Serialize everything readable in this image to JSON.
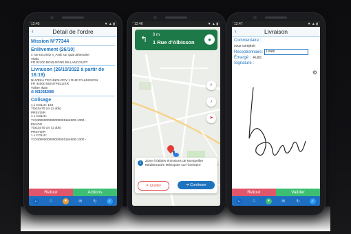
{
  "phone1": {
    "statusbar_left": "12:45",
    "statusbar_right": "▼ ▲ ▮",
    "title": "Détail de l'ordre",
    "mission": "Mission N°77344",
    "enlevement": {
      "heading": "Enlèvement (26/10)",
      "lines": [
        "4 rue ISLAND 4_ANE sur quai athenaise",
        "Vitalo",
        "FR 92100 BOULOGNE BILLANCOURT"
      ]
    },
    "livraison": {
      "heading": "Livraison (26/10/2022 à partir de 16:19)",
      "lines": [
        "NUVEKA TECHNOLOGY 1 RUE D'ALBISSON",
        "FR 34000 MONTPELLIER",
        "Volker Ikam"
      ],
      "phone": "0610582680"
    },
    "colisage": {
      "heading": "Colisage",
      "lines": [
        "1 x COLIS: 123",
        "70x15x70 cm (1 obk)",
        "PREVOIR",
        "1 x COLIS:",
        "Y234000000000000001164900-1300 -",
        "ENLOG",
        "70x15x70 cm (1 obk)",
        "PREVOIR",
        "1 x COLIS:",
        "Y234000000000000001164900-1300 -"
      ]
    },
    "retour_label": "Retour",
    "actions_label": "Actions"
  },
  "phone2": {
    "statusbar_left": "12:46",
    "statusbar_right": "▼ ▲ ▮",
    "distance": "0 m",
    "street": "1 Rue d'Albisson",
    "zone_text": "Zone à faibles émissions de Montpellier Méditerranée Métropole sur l'itinéraire",
    "quitter_label": "Quitter",
    "continuer_label": "Continuer",
    "place_label": "Place de la Comédie",
    "colors": {
      "nav_green": "#1d7a48",
      "route_blue": "#1e73be"
    }
  },
  "phone3": {
    "statusbar_left": "12:47",
    "statusbar_right": "▼ ▲ ▮",
    "title": "Livraison",
    "commentaire_label": "Commentaire :",
    "commentaire_value": "sous comptoir",
    "receptionnaire_label": "Réceptionnaire:",
    "receptionnaire_value": "Louis",
    "emarge_label": "Émargé :",
    "emarge_value": "Rudic",
    "signature_label": "Signature :",
    "retour_label": "Retour",
    "valider_label": "Valider"
  },
  "navbar_icons": [
    "back-icon",
    "home-icon",
    "map-pin-icon",
    "mail-icon",
    "refresh-icon",
    "check-icon"
  ]
}
